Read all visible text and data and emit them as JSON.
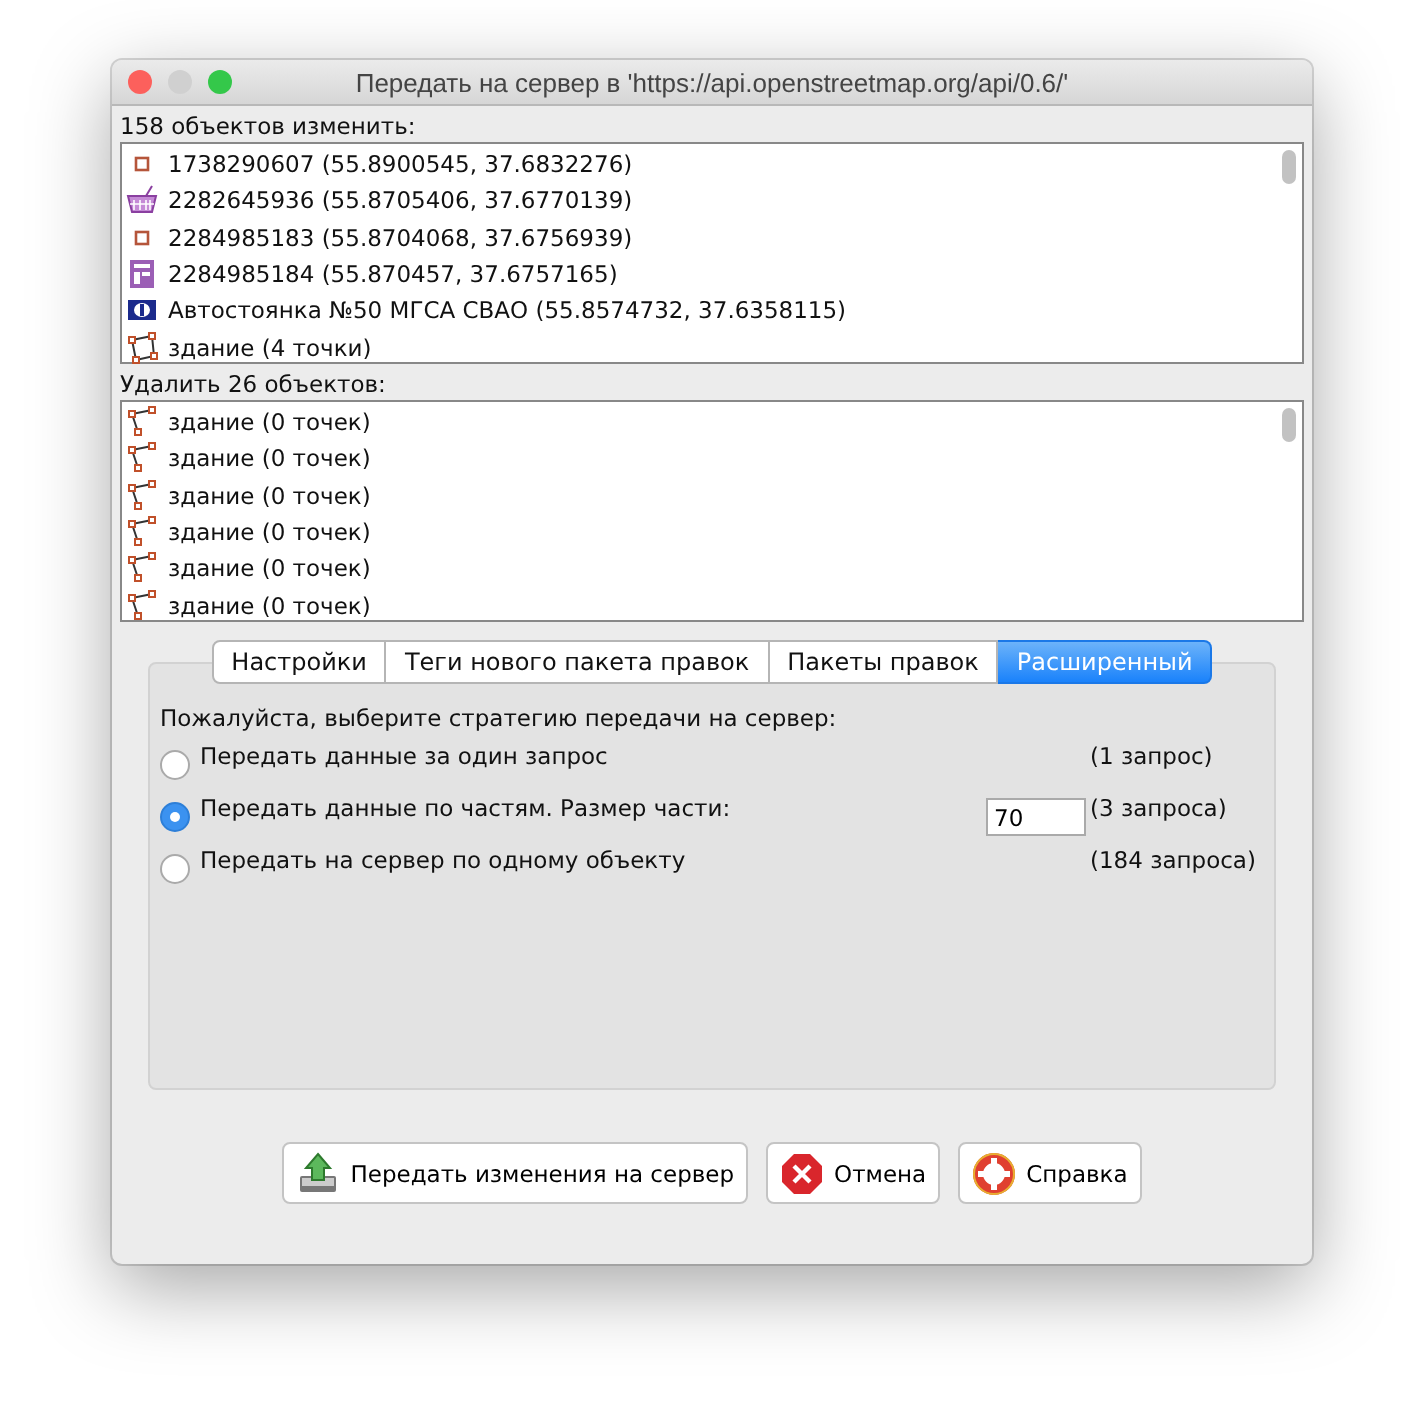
{
  "window": {
    "title": "Передать на сервер в 'https://api.openstreetmap.org/api/0.6/'"
  },
  "modify": {
    "label": "158 объектов изменить:",
    "items": [
      {
        "kind": "node",
        "text": "1738290607 (55.8900545, 37.6832276)"
      },
      {
        "kind": "shop",
        "text": "2282645936 (55.8705406, 37.6770139)"
      },
      {
        "kind": "node",
        "text": "2284985183 (55.8704068, 37.6756939)"
      },
      {
        "kind": "poi",
        "text": "2284985184 (55.870457, 37.6757165)"
      },
      {
        "kind": "parking",
        "text": "Автостоянка №50 МГСА СВАО (55.8574732, 37.6358115)"
      },
      {
        "kind": "area",
        "text": "здание (4 точки)"
      }
    ]
  },
  "delete": {
    "label": "Удалить 26 объектов:",
    "items": [
      {
        "kind": "way",
        "text": "здание (0 точек)"
      },
      {
        "kind": "way",
        "text": "здание (0 точек)"
      },
      {
        "kind": "way",
        "text": "здание (0 точек)"
      },
      {
        "kind": "way",
        "text": "здание (0 точек)"
      },
      {
        "kind": "way",
        "text": "здание (0 точек)"
      },
      {
        "kind": "way",
        "text": "здание (0 точек)"
      }
    ]
  },
  "tabs": [
    {
      "label": "Настройки",
      "selected": false
    },
    {
      "label": "Теги нового пакета правок",
      "selected": false
    },
    {
      "label": "Пакеты правок",
      "selected": false
    },
    {
      "label": "Расширенный",
      "selected": true
    }
  ],
  "strategy": {
    "prompt": "Пожалуйста, выберите стратегию передачи на сервер:",
    "options": [
      {
        "label": "Передать данные за один запрос",
        "selected": false,
        "count": "(1 запрос)"
      },
      {
        "label": "Передать данные по частям. Размер части:",
        "selected": true,
        "value": "70",
        "count": "(3 запроса)"
      },
      {
        "label": "Передать на сервер по одному объекту",
        "selected": false,
        "count": "(184 запроса)"
      }
    ]
  },
  "buttons": [
    {
      "kind": "upload",
      "label": "Передать изменения на сервер"
    },
    {
      "kind": "cancel",
      "label": "Отмена"
    },
    {
      "kind": "help",
      "label": "Справка"
    }
  ]
}
